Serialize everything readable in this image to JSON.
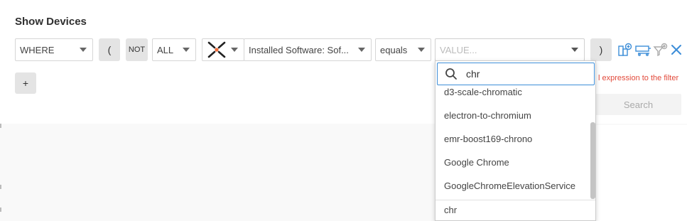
{
  "header": {
    "title": "Show Devices"
  },
  "filter_row": {
    "where": "WHERE",
    "open_paren": "(",
    "not": "NOT",
    "all": "ALL",
    "field": "Installed Software: Sof...",
    "operator": "equals",
    "value_placeholder": "VALUE...",
    "close_paren": ")"
  },
  "add_button": "+",
  "error_text": "l expression to the filter",
  "search_button": "Search",
  "dropdown": {
    "search_value": "chr",
    "items": [
      "d3-scale-chromatic",
      "electron-to-chromium",
      "emr-boost169-chrono",
      "Google Chrome",
      "GoogleChromeElevationService"
    ],
    "footer": "chr"
  },
  "icons": {
    "adapter": "adapter-logo-icon",
    "add_condition": "add-condition-icon",
    "add_nested": "add-nested-icon",
    "add_filter": "add-filter-icon",
    "remove": "close-icon",
    "search": "search-icon"
  },
  "colors": {
    "accent": "#3d8ed8",
    "error": "#e24a3b",
    "adapter_dot": "#f26a36"
  }
}
